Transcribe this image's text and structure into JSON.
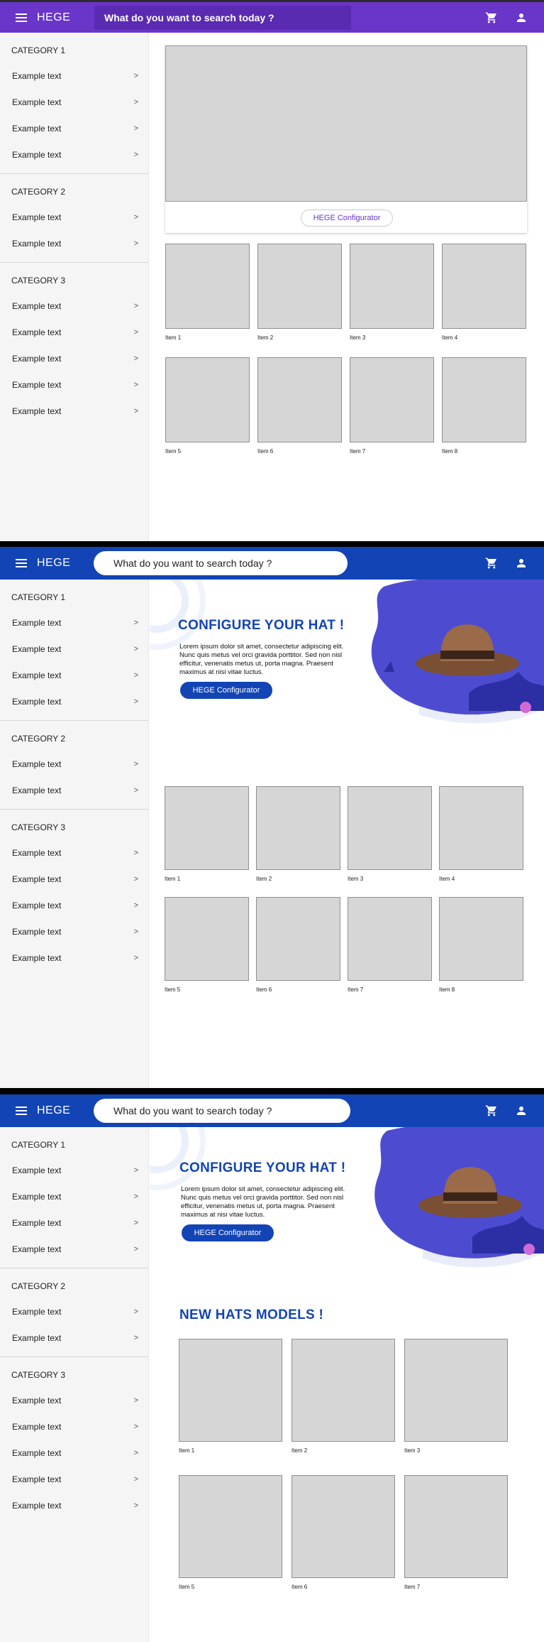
{
  "brand": "HEGE",
  "search_placeholder": "What do you want to search today ?",
  "categories": [
    {
      "title": "CATEGORY 1",
      "items": [
        "Example text",
        "Example text",
        "Example text",
        "Example text"
      ]
    },
    {
      "title": "CATEGORY 2",
      "items": [
        "Example text",
        "Example text"
      ]
    },
    {
      "title": "CATEGORY 3",
      "items": [
        "Example text",
        "Example text",
        "Example text",
        "Example text",
        "Example text"
      ]
    }
  ],
  "configurator_label": "HEGE Configurator",
  "hero": {
    "title": "CONFIGURE YOUR HAT !",
    "text": "Lorem ipsum dolor sit amet, consectetur adipiscing elit. Nunc quis metus vel orci gravida porttitor. Sed non nisl efficitur, venenatis metus ut, porta magna. Praesent maximus at nisi vitae luctus."
  },
  "new_models_title": "NEW HATS MODELS !",
  "items": [
    "Item 1",
    "Item 2",
    "Item 3",
    "Item 4",
    "Item 5",
    "Item 6",
    "Item 7",
    "Item 8"
  ],
  "colors": {
    "purple": "#6a35c9",
    "blue": "#1244b5",
    "placeholder": "#d6d6d6"
  },
  "icons": [
    "menu-icon",
    "cart-icon",
    "user-icon",
    "chevron-right-icon"
  ]
}
